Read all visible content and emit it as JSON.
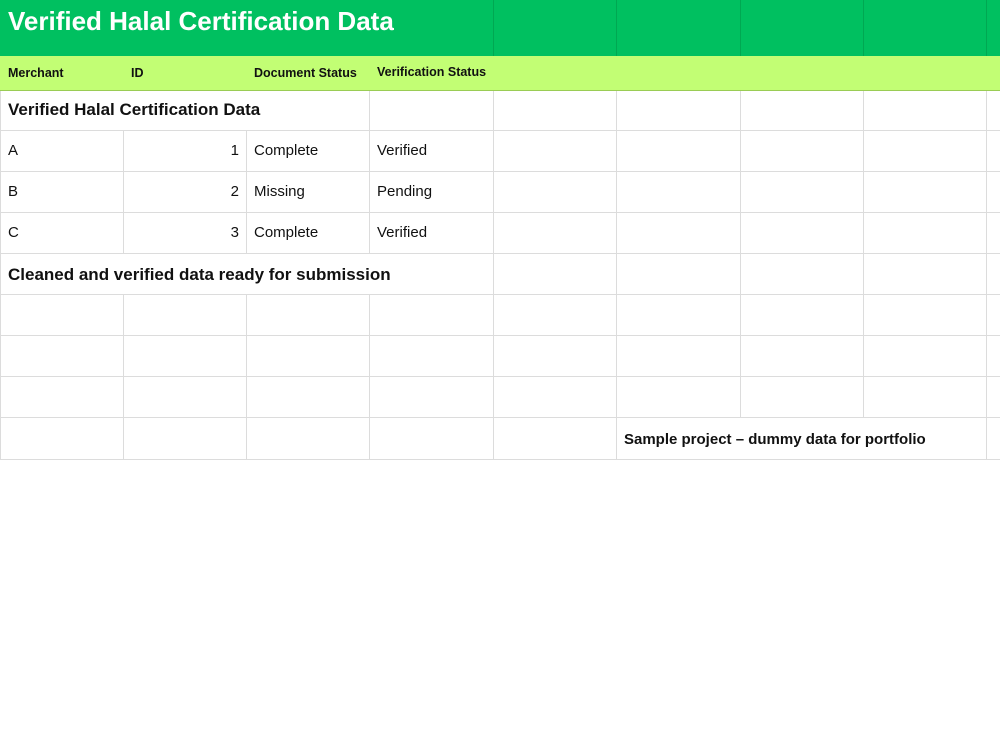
{
  "title": "Verified Halal Certification Data",
  "headers": {
    "merchant": "Merchant",
    "id": "ID",
    "document_status": "Document Status",
    "verification_status": "Verification Status"
  },
  "section_title": "Verified Halal Certification Data",
  "rows": [
    {
      "merchant": "A",
      "id": "1",
      "document_status": "Complete",
      "verification_status": "Verified"
    },
    {
      "merchant": "B",
      "id": "2",
      "document_status": "Missing",
      "verification_status": "Pending"
    },
    {
      "merchant": "C",
      "id": "3",
      "document_status": "Complete",
      "verification_status": "Verified"
    }
  ],
  "note": "Cleaned and verified data ready for submission",
  "footer": "Sample project – dummy data for portfolio",
  "colors": {
    "title_band": "#00c060",
    "header_band": "#c2fe74",
    "title_text": "#ffffff"
  }
}
